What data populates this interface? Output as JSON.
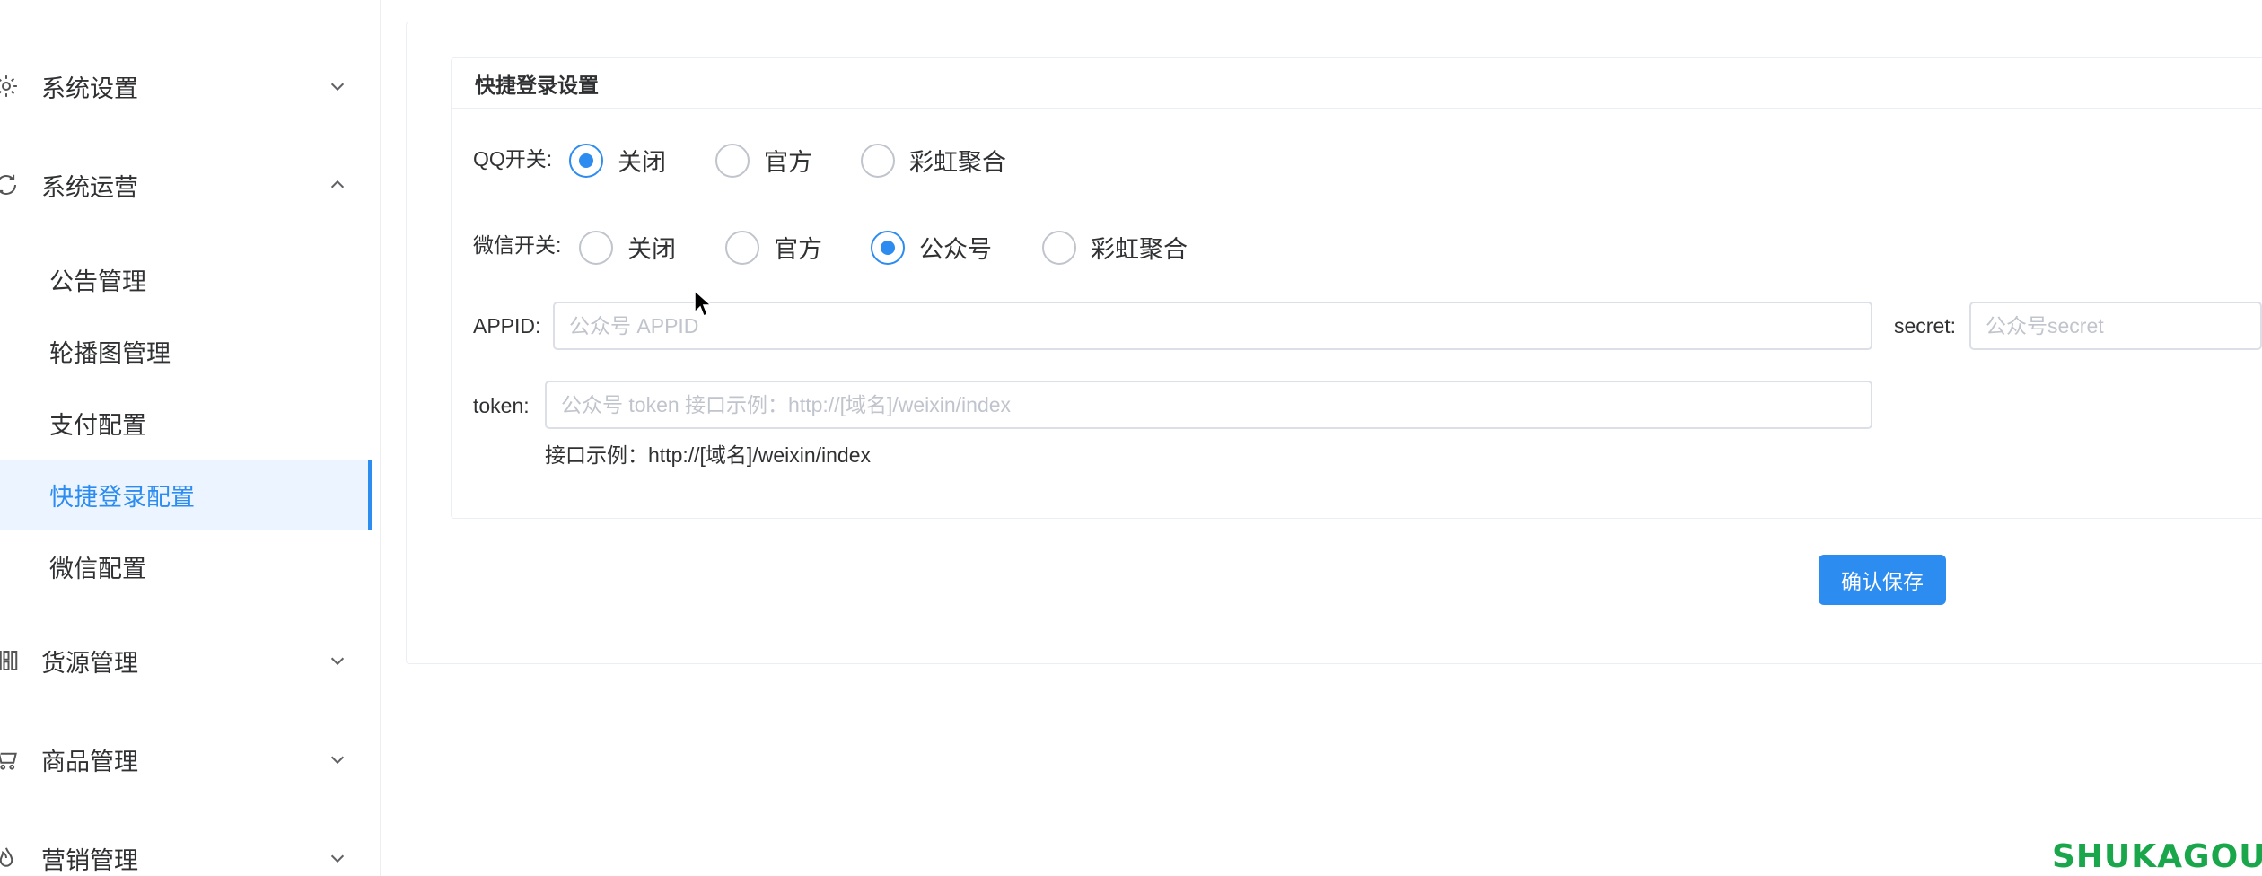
{
  "sidebar": {
    "groups": [
      {
        "label": "系统设置",
        "icon": "gear-icon",
        "expanded": false
      },
      {
        "label": "系统运营",
        "icon": "operations-icon",
        "expanded": true
      },
      {
        "label": "货源管理",
        "icon": "grid-icon",
        "expanded": false
      },
      {
        "label": "商品管理",
        "icon": "cart-icon",
        "expanded": false
      },
      {
        "label": "营销管理",
        "icon": "fire-icon",
        "expanded": false
      }
    ],
    "submenu": [
      {
        "label": "公告管理",
        "active": false
      },
      {
        "label": "轮播图管理",
        "active": false
      },
      {
        "label": "支付配置",
        "active": false
      },
      {
        "label": "快捷登录配置",
        "active": true
      },
      {
        "label": "微信配置",
        "active": false
      }
    ]
  },
  "panel": {
    "title": "快捷登录设置"
  },
  "form": {
    "qq": {
      "label": "QQ开关:",
      "options": [
        "关闭",
        "官方",
        "彩虹聚合"
      ],
      "selected": "关闭"
    },
    "wechat": {
      "label": "微信开关:",
      "options": [
        "关闭",
        "官方",
        "公众号",
        "彩虹聚合"
      ],
      "selected": "公众号"
    },
    "appid": {
      "label": "APPID:",
      "value": "",
      "placeholder": "公众号 APPID"
    },
    "secret": {
      "label": "secret:",
      "value": "",
      "placeholder": "公众号secret"
    },
    "token": {
      "label": "token:",
      "value": "",
      "placeholder": "公众号 token 接口示例：http://[域名]/weixin/index",
      "hint": "接口示例：http://[域名]/weixin/index"
    }
  },
  "actions": {
    "save_label": "确认保存"
  },
  "watermark": "SHUKAGOU",
  "colors": {
    "accent": "#2d8cf0",
    "active_bg": "#ecf5ff",
    "watermark": "#1aa64a"
  }
}
